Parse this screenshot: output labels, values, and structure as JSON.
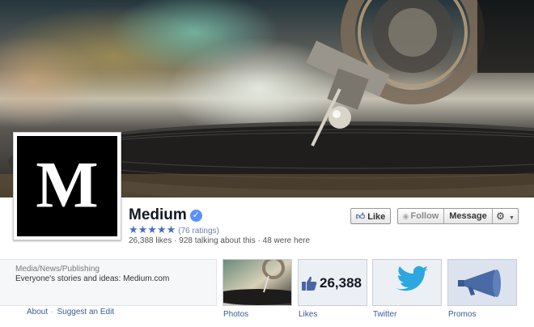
{
  "page": {
    "name": "Medium",
    "logo_letter": "M",
    "verified_mark": "✓",
    "stars": "★★★★★",
    "rating_count": "(76 ratings)",
    "stats": "26,388 likes · 928 talking about this · 48 were here"
  },
  "actions": {
    "like_label": "Like",
    "follow_label": "Follow",
    "message_label": "Message",
    "settings_icon": "gear-icon",
    "settings_caret": "▼"
  },
  "about": {
    "category": "Media/News/Publishing",
    "description": "Everyone's stories and ideas: Medium.com",
    "links": [
      "About",
      "Suggest an Edit"
    ],
    "link_separator": "·"
  },
  "tiles": [
    {
      "label": "Photos"
    },
    {
      "label": "Likes",
      "value": "26,388"
    },
    {
      "label": "Twitter"
    },
    {
      "label": "Promos"
    }
  ],
  "colors": {
    "link": "#3b5998",
    "twitter_blue": "#2ca7e0",
    "promo_blue": "#4a6aa5"
  }
}
